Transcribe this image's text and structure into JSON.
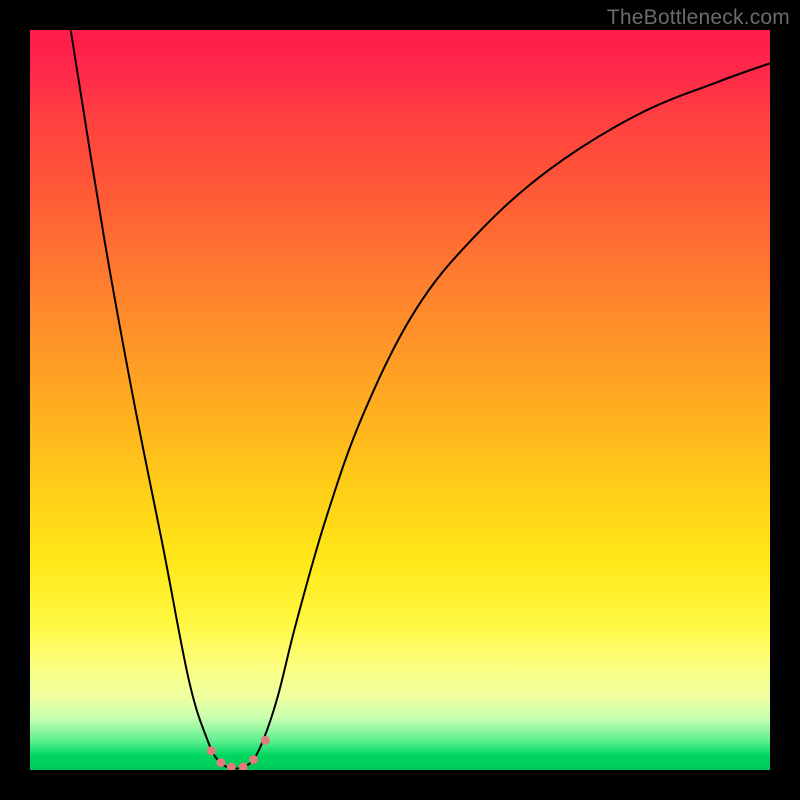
{
  "watermark": "TheBottleneck.com",
  "chart_data": {
    "type": "line",
    "title": "",
    "xlabel": "",
    "ylabel": "",
    "xlim": [
      0,
      1
    ],
    "ylim": [
      0,
      1
    ],
    "series": [
      {
        "name": "curve",
        "x": [
          0.055,
          0.1,
          0.14,
          0.18,
          0.215,
          0.24,
          0.255,
          0.27,
          0.285,
          0.3,
          0.315,
          0.335,
          0.36,
          0.4,
          0.45,
          0.52,
          0.6,
          0.7,
          0.82,
          0.93,
          1.0
        ],
        "y": [
          1.0,
          0.72,
          0.5,
          0.3,
          0.12,
          0.04,
          0.012,
          0.003,
          0.003,
          0.012,
          0.04,
          0.1,
          0.2,
          0.34,
          0.48,
          0.62,
          0.72,
          0.81,
          0.885,
          0.93,
          0.955
        ],
        "color": "#000000",
        "width": 2.0
      },
      {
        "name": "markers",
        "type": "scatter",
        "x": [
          0.245,
          0.258,
          0.272,
          0.288,
          0.302,
          0.318
        ],
        "y": [
          0.026,
          0.01,
          0.004,
          0.004,
          0.014,
          0.04
        ],
        "color": "#e37b7b",
        "size": 9
      }
    ],
    "background_gradient": {
      "top": "#ff1a4a",
      "middle": "#ffce18",
      "bottom": "#00c858"
    }
  }
}
